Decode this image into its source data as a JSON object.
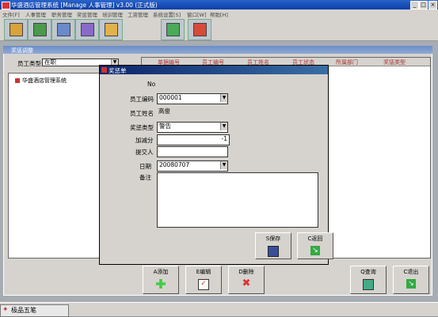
{
  "window": {
    "title": "华盛酒店管理系统 [Manage 人事管理] v3.00 (正式版)",
    "min": "_",
    "max": "□",
    "close": "×"
  },
  "menu": [
    "文件[F]",
    "人事管理",
    "职务管理",
    "奖惩管理",
    "培训管理",
    "工资管理",
    "系统设置[S]",
    "窗口[W]",
    "帮助[H]"
  ],
  "toolbar": [
    "tb1-icon",
    "tb2-icon",
    "tb3-icon",
    "tb4-icon",
    "tb5-icon",
    "tb6-icon",
    "tb7-icon"
  ],
  "panel": {
    "title": "奖惩调整",
    "emp_type_label": "员工类型:",
    "emp_type_value": "在职",
    "tree_root": "华盛酒店管理系统"
  },
  "grid": {
    "headers": [
      "单据编号",
      "员工编号",
      "员工姓名",
      "员工状态",
      "所属部门",
      "奖惩类型"
    ]
  },
  "buttons": {
    "add": "A添加",
    "edit": "E编辑",
    "delete": "D删除",
    "query": "Q查询",
    "close": "C退出"
  },
  "dialog": {
    "title": "奖惩单",
    "no_label": "No",
    "emp_code_label": "员工编码",
    "emp_code": "000001",
    "emp_name_label": "员工姓名",
    "emp_name": "高俊",
    "type_label": "奖惩类型",
    "type": "警告",
    "points_label": "加减分",
    "points": "-1",
    "submitter_label": "提交人",
    "submitter": "",
    "date_label": "日期",
    "date": "20080707",
    "note_label": "备注",
    "note": "",
    "save": "S保存",
    "back": "C返回"
  },
  "taskbar": {
    "ime": "极品五笔"
  }
}
